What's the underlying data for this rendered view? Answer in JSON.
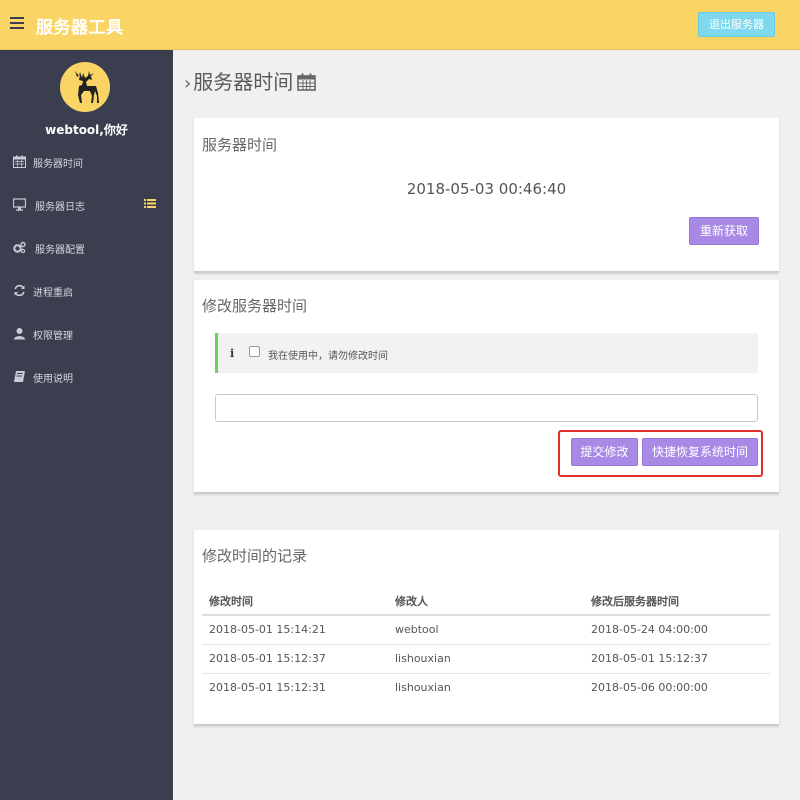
{
  "header": {
    "title": "服务器工具",
    "exit_label": "退出服务器"
  },
  "colors": {
    "topbar": "#fad566",
    "sidebar": "#3b3e4f",
    "exit_button": "#7fd9ee",
    "primary_button": "#a889e6",
    "notice_border": "#6cd35a",
    "highlight": "#e0302a"
  },
  "sidebar": {
    "username": "webtool,你好",
    "items": [
      {
        "label": "服务器时间",
        "icon": "calendar-icon"
      },
      {
        "label": "服务器日志",
        "icon": "monitor-icon"
      },
      {
        "label": "服务器配置",
        "icon": "cogs-icon"
      },
      {
        "label": "进程重启",
        "icon": "refresh-icon"
      },
      {
        "label": "权限管理",
        "icon": "user-icon"
      },
      {
        "label": "使用说明",
        "icon": "book-icon"
      }
    ]
  },
  "page": {
    "title": "服务器时间"
  },
  "server_time_panel": {
    "title": "服务器时间",
    "time": "2018-05-03 00:46:40",
    "refresh_label": "重新获取"
  },
  "modify_panel": {
    "title": "修改服务器时间",
    "notice_text": "我在使用中，请勿修改时间",
    "input_value": "",
    "submit_label": "提交修改",
    "restore_label": "快捷恢复系统时间"
  },
  "records_panel": {
    "title": "修改时间的记录",
    "columns": [
      "修改时间",
      "修改人",
      "修改后服务器时间"
    ],
    "rows": [
      [
        "2018-05-01 15:14:21",
        "webtool",
        "2018-05-24 04:00:00"
      ],
      [
        "2018-05-01 15:12:37",
        "lishouxian",
        "2018-05-01 15:12:37"
      ],
      [
        "2018-05-01 15:12:31",
        "lishouxian",
        "2018-05-06 00:00:00"
      ]
    ]
  }
}
